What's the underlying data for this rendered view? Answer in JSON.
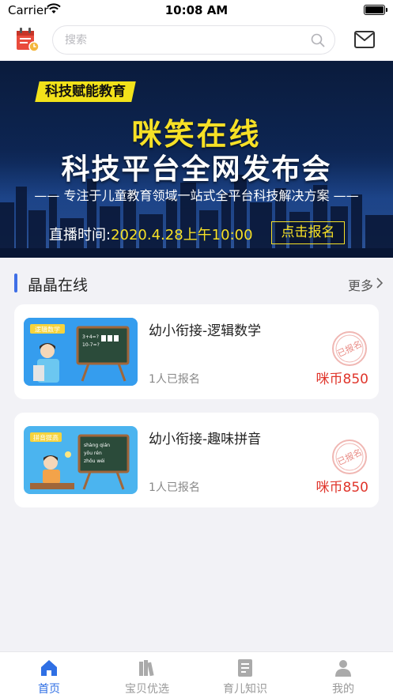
{
  "status_bar": {
    "carrier": "Carrier",
    "time": "10:08 AM"
  },
  "header": {
    "search_placeholder": "搜索",
    "icons": [
      "calendar-icon",
      "search-icon",
      "mail-icon"
    ]
  },
  "banner": {
    "tag": "科技赋能教育",
    "title_line1": "咪笑在线",
    "title_line2": "科技平台全网发布会",
    "subtitle": "—— 专注于儿童教育领域一站式全平台科技解决方案 ——",
    "live_label": "直播时间:",
    "live_time": "2020.4.28上午10:00",
    "register_button": "点击报名",
    "colors": {
      "accent": "#f6e026",
      "background": "#0d2552"
    }
  },
  "section": {
    "title": "晶晶在线",
    "more": "更多",
    "accent_color": "#3f6fe6"
  },
  "courses": [
    {
      "title": "幼小衔接-逻辑数学",
      "thumb_tag": "逻辑数学",
      "enrolled": "1人已报名",
      "price": "咪币850",
      "stamp": "已报名"
    },
    {
      "title": "幼小衔接-趣味拼音",
      "thumb_tag": "拼音提高",
      "enrolled": "1人已报名",
      "price": "咪币850",
      "stamp": "已报名"
    }
  ],
  "tab_bar": {
    "active_color": "#2f6fe4",
    "items": [
      {
        "label": "首页",
        "icon": "home-icon",
        "active": true
      },
      {
        "label": "宝贝优选",
        "icon": "books-icon",
        "active": false
      },
      {
        "label": "育儿知识",
        "icon": "document-icon",
        "active": false
      },
      {
        "label": "我的",
        "icon": "user-icon",
        "active": false
      }
    ]
  }
}
